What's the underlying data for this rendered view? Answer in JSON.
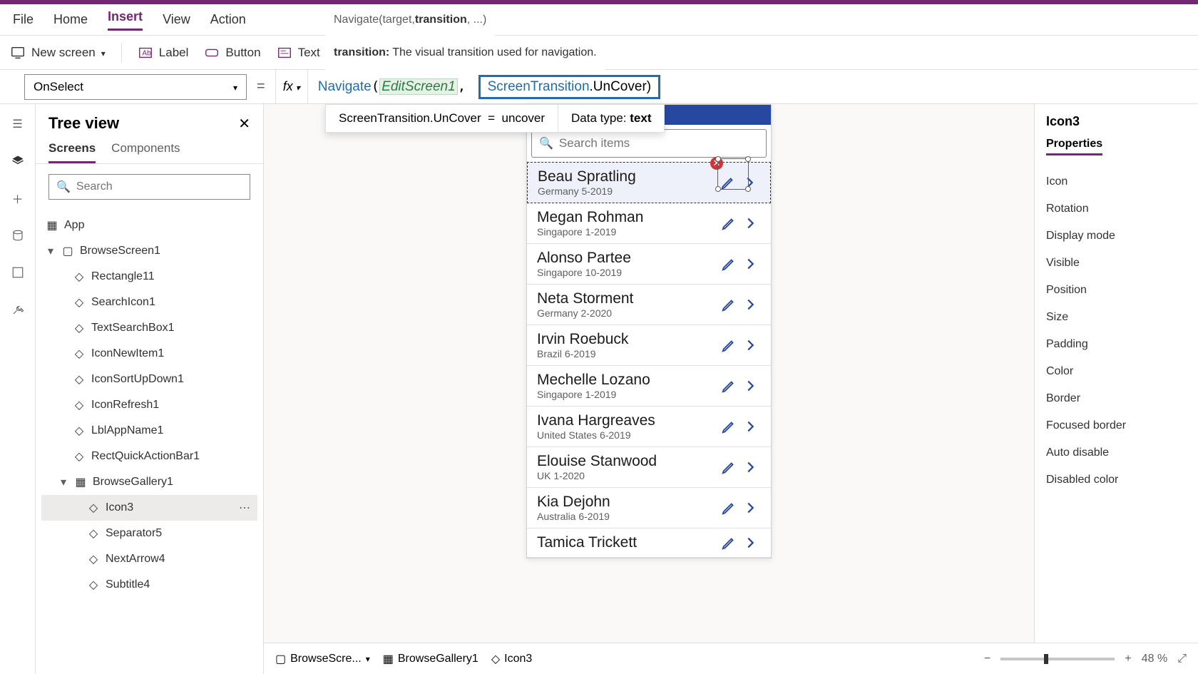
{
  "menu": {
    "file": "File",
    "home": "Home",
    "insert": "Insert",
    "view": "View",
    "action": "Action"
  },
  "signature": {
    "text_pre": "Navigate(target, ",
    "text_bold": "transition",
    "text_post": ", ...)"
  },
  "ribbon": {
    "new_screen": "New screen",
    "label": "Label",
    "button": "Button",
    "text": "Text"
  },
  "param_hint": {
    "name": "transition:",
    "desc": "The visual transition used for navigation."
  },
  "property_dropdown": "OnSelect",
  "formula": {
    "fn": "Navigate",
    "arg1": "EditScreen1",
    "enum": "ScreenTransition",
    "member": ".UnCover"
  },
  "fx_result": {
    "lhs": "ScreenTransition.UnCover",
    "eq": "=",
    "rhs": "uncover",
    "dtype_label": "Data type:",
    "dtype": "text"
  },
  "tree": {
    "title": "Tree view",
    "tabs": {
      "screens": "Screens",
      "components": "Components"
    },
    "search_placeholder": "Search",
    "app": "App",
    "screen": "BrowseScreen1",
    "items": [
      "Rectangle11",
      "SearchIcon1",
      "TextSearchBox1",
      "IconNewItem1",
      "IconSortUpDown1",
      "IconRefresh1",
      "LblAppName1",
      "RectQuickActionBar1"
    ],
    "gallery": "BrowseGallery1",
    "gallery_items": [
      "Icon3",
      "Separator5",
      "NextArrow4",
      "Subtitle4"
    ]
  },
  "phone": {
    "search_placeholder": "Search items",
    "rows": [
      {
        "name": "Beau Spratling",
        "sub": "Germany 5-2019"
      },
      {
        "name": "Megan Rohman",
        "sub": "Singapore 1-2019"
      },
      {
        "name": "Alonso Partee",
        "sub": "Singapore 10-2019"
      },
      {
        "name": "Neta Storment",
        "sub": "Germany 2-2020"
      },
      {
        "name": "Irvin Roebuck",
        "sub": "Brazil 6-2019"
      },
      {
        "name": "Mechelle Lozano",
        "sub": "Singapore 1-2019"
      },
      {
        "name": "Ivana Hargreaves",
        "sub": "United States 6-2019"
      },
      {
        "name": "Elouise Stanwood",
        "sub": "UK 1-2020"
      },
      {
        "name": "Kia Dejohn",
        "sub": "Australia 6-2019"
      },
      {
        "name": "Tamica Trickett",
        "sub": ""
      }
    ]
  },
  "props": {
    "selected": "Icon3",
    "tab": "Properties",
    "rows": [
      "Icon",
      "Rotation",
      "Display mode",
      "Visible",
      "Position",
      "Size",
      "Padding",
      "Color",
      "Border",
      "Focused border",
      "Auto disable",
      "Disabled color"
    ]
  },
  "breadcrumb": {
    "a": "BrowseScre...",
    "b": "BrowseGallery1",
    "c": "Icon3",
    "zoom": "48  %"
  }
}
